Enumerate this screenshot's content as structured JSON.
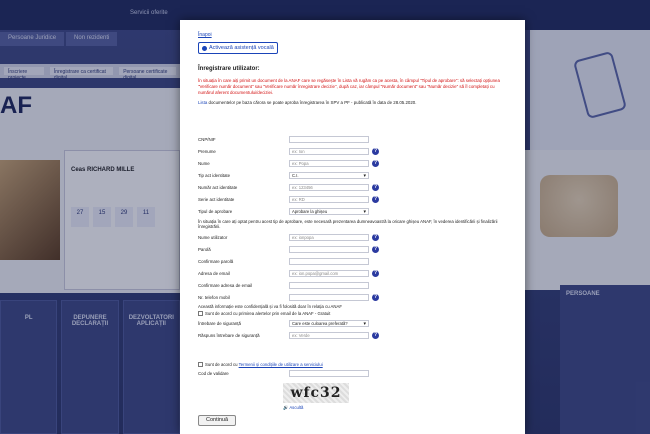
{
  "background": {
    "topbar_text": "Servicii oferite",
    "tabs": [
      "Persoane Juridice",
      "Non rezidenti"
    ],
    "nav": [
      "Înscriere proiecte",
      "Înregistrare ca certificat digital",
      "Persoane certificate digital"
    ],
    "logo": "AF",
    "card_title": "Ceas RICHARD MILLE",
    "stats": [
      "27",
      "15",
      "29",
      "11"
    ],
    "panels": [
      "PL",
      "DEPUNERE DECLARAȚII",
      "DEZVOLTATORI APLICAȚII"
    ],
    "right_panel": "PERSOANE"
  },
  "modal": {
    "back_link": "Înapoi",
    "assist_button": "Activează asistență vocală",
    "section_title": "Înregistrare utilizator:",
    "intro_text": "În situația în care aiți primit un document de la ANAF care se regăsește în Lista vă rugăm ca pe acesta, în câmpul \"Tipul de aprobare\": să selectați opțiunea \"Verificare număr document\" sau \"Verificare număr înregistrare decizie\", după caz, iar câmpul \"Număr document\" sau \"Număr decizie\" să îl completați cu numărul aferent documentului/deciziei.",
    "list_note_link": "Lista",
    "list_note_text": " documentelor pe baza cărora se poate aproba înregistrarea în SPV a PF - publicată în data de 28.05.2020.",
    "fields": [
      {
        "label": "CNP/NIF",
        "placeholder": "",
        "help": false
      },
      {
        "label": "Prenume",
        "placeholder": "ex: Ion",
        "help": true
      },
      {
        "label": "Nume",
        "placeholder": "ex: Popa",
        "help": true
      },
      {
        "label": "Tip act identitate",
        "value": "C.I.",
        "select": true,
        "help": false
      },
      {
        "label": "Număr act identitate",
        "placeholder": "ex: 123456",
        "help": true
      },
      {
        "label": "Serie act identitate",
        "placeholder": "ex: RD",
        "help": true
      },
      {
        "label": "Tipul de aprobare",
        "value": "Aprobare la ghișeu",
        "select": true,
        "help": false
      }
    ],
    "approval_note": "În situația în care ați optat pentru acest tip de aprobare, este necesară prezentarea dumneavoastră la oricare ghișeu ANAF, în vederea identificării și finalizării înregistrării.",
    "fields2": [
      {
        "label": "Nume utilizator",
        "placeholder": "ex: ionpopa",
        "help": true
      },
      {
        "label": "Parolă",
        "placeholder": "",
        "help": true
      },
      {
        "label": "Confirmare parolă",
        "placeholder": "",
        "help": false
      },
      {
        "label": "Adresa de email",
        "placeholder": "ex: ion.popa@gmail.com",
        "help": true
      },
      {
        "label": "Confirmare adresa de email",
        "placeholder": "",
        "help": false
      },
      {
        "label": "Nr. telefon mobil",
        "placeholder": "",
        "help": true
      }
    ],
    "sms_note": "Această informație este confidențială și va fi folosită doar în relația cu ANAF",
    "sms_check": "Sunt de acord cu primirea alertelor prin email de la ANAF - Gratuit",
    "fields3": [
      {
        "label": "Întrebare de siguranță",
        "value": "Care este culoarea preferată?",
        "select": true,
        "help": false
      },
      {
        "label": "Răspuns întrebare de siguranță",
        "placeholder": "ex: Verde",
        "help": true
      }
    ],
    "terms_prefix": "Sunt de acord cu ",
    "terms_link": "Termenii și condițiile de utilizare a serviciului",
    "captcha_label": "Cod de validare",
    "captcha_text": "wfc32",
    "audio_link": "Ascultă",
    "submit_label": "Continuă"
  }
}
